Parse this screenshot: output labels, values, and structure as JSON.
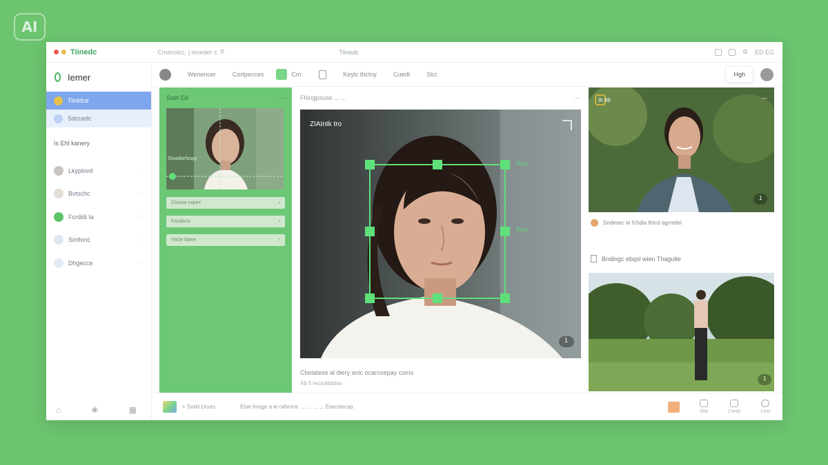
{
  "badge": {
    "label": "AI"
  },
  "titlebar": {
    "app_name": "Tiinedc",
    "search_text": "Cmecolcc. | ieneder c",
    "center_text": "Tiinedc",
    "right_text": "ED EG",
    "dot_colors": [
      "#e8574a",
      "#f0b94a"
    ]
  },
  "sidebar": {
    "brand": "Iemer",
    "items": [
      {
        "label": "Tiinldce"
      },
      {
        "label": "Sdccedc"
      }
    ],
    "group_label": "Is Ehl kanery",
    "rows": [
      {
        "label": "Lkyplovd",
        "meta": "···"
      },
      {
        "label": "Bvtschc",
        "meta": "···"
      },
      {
        "label": "Fcrdidi la",
        "meta": "···"
      },
      {
        "label": "Sintlonc",
        "meta": "···"
      },
      {
        "label": "Dhgecce",
        "meta": "···"
      }
    ]
  },
  "toolbar": {
    "items": [
      "Wenencer",
      "Cortpecces",
      "Cm",
      "Keylc thctny",
      "Cuedt",
      "Stci"
    ],
    "button_label": "Hgh"
  },
  "left_panel": {
    "title": "Suirl Gil",
    "menu": "···",
    "overlay_label": "Sloadiarfaspy",
    "fields": [
      "Clucise iuipex",
      "Facidvcs",
      "Vticle ildere"
    ]
  },
  "center_panel": {
    "title": "Fhingpsuse ... ...",
    "menu": "···",
    "image_label": "ZIAIntk tro",
    "handle_label_top": "Tonc",
    "handle_label_mid": "Rroc",
    "counter": "1",
    "caption": "Cbelatese al diery anic ocarcoepay coms",
    "sub": "Ab 5 Iecsolliddoo"
  },
  "right_panel": {
    "card1_tag": "Ih 86",
    "card1_menu": "—",
    "card1_counter": "1",
    "label1": "Sndesec le fchdia thtcd agrntdel",
    "label2": "Bndingc ebqsl wien Thagulte",
    "card2_counter": "1"
  },
  "footer": {
    "text1": "+ Sorkl Ucurs",
    "text2": "Eise lmsge a ie rahrnce. ... ... ... ... Eeersiecsp.",
    "actions": [
      "Stie",
      "Conie",
      "Lmo"
    ]
  },
  "colors": {
    "background": "#6cc46f",
    "accent": "#5fe07a",
    "sidebar_active": "#7ea6ec",
    "panel_green": "#6dc876"
  }
}
